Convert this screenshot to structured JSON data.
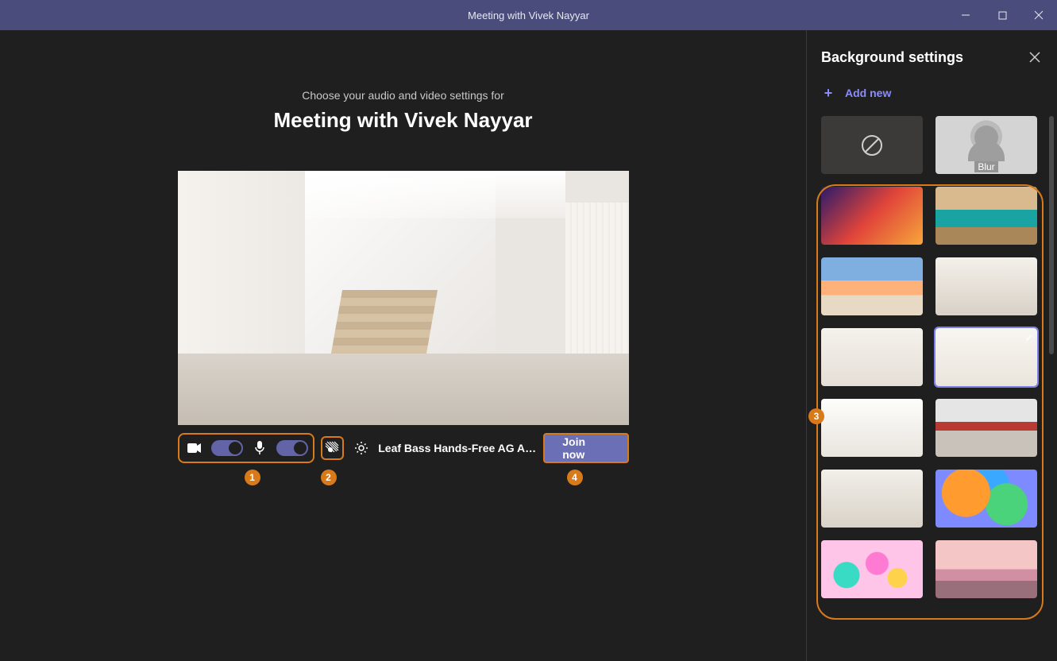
{
  "titlebar": {
    "title": "Meeting with Vivek Nayyar"
  },
  "main": {
    "subtitle": "Choose your audio and video settings for",
    "meeting_title": "Meeting with Vivek Nayyar",
    "audio_device": "Leaf Bass Hands-Free AG Au…",
    "join_label": "Join now"
  },
  "badges": {
    "b1": "1",
    "b2": "2",
    "b3": "3",
    "b4": "4"
  },
  "sidebar": {
    "title": "Background settings",
    "add_new": "Add new",
    "blur_label": "Blur"
  }
}
